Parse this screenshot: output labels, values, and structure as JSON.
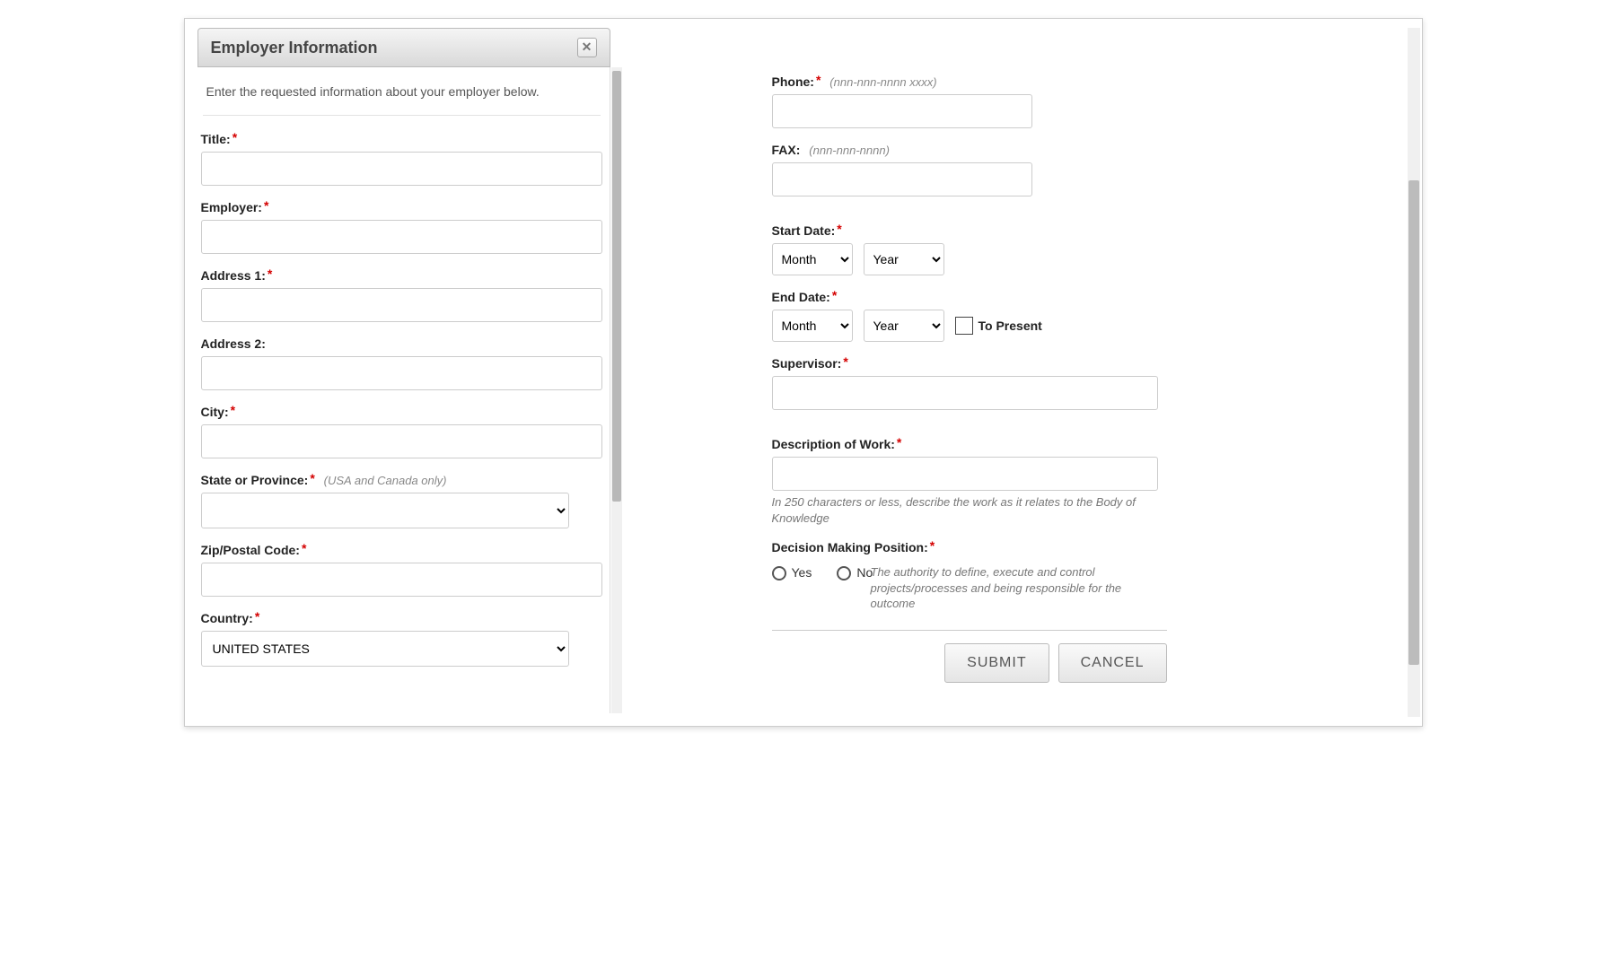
{
  "dialog": {
    "title": "Employer Information",
    "intro": "Enter the requested information about your employer below."
  },
  "left": {
    "title_label": "Title:",
    "employer_label": "Employer:",
    "address1_label": "Address 1:",
    "address2_label": "Address 2:",
    "city_label": "City:",
    "state_label": "State or Province:",
    "state_hint": "(USA and Canada only)",
    "zip_label": "Zip/Postal Code:",
    "country_label": "Country:",
    "country_value": "UNITED STATES"
  },
  "right": {
    "phone_label": "Phone:",
    "phone_hint": "(nnn-nnn-nnnn xxxx)",
    "fax_label": "FAX:",
    "fax_hint": "(nnn-nnn-nnnn)",
    "start_label": "Start Date:",
    "end_label": "End Date:",
    "month_option": "Month",
    "year_option": "Year",
    "to_present_label": "To Present",
    "supervisor_label": "Supervisor:",
    "desc_label": "Description of Work:",
    "desc_help": "In 250 characters or less, describe the work as it relates to the Body of Knowledge",
    "decision_label": "Decision Making Position:",
    "yes_label": "Yes",
    "no_label": "No",
    "decision_help": "The authority to define, execute and control projects/processes and being responsible for the outcome"
  },
  "buttons": {
    "submit": "SUBMIT",
    "cancel": "CANCEL"
  }
}
